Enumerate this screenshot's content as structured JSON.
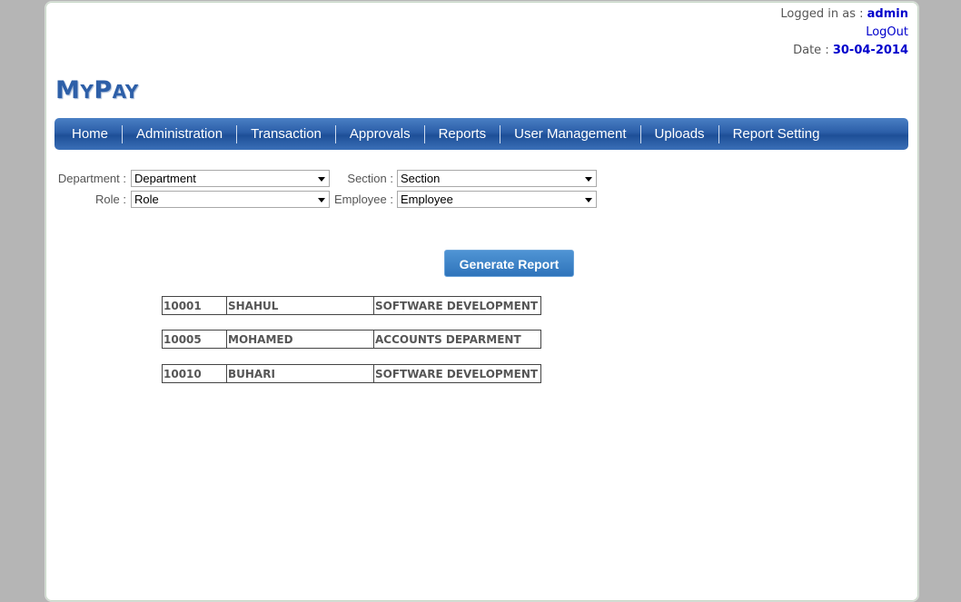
{
  "header": {
    "logged_in_label": "Logged in as :",
    "user": "admin",
    "logout": "LogOut",
    "date_label": "Date :",
    "date": "30-04-2014"
  },
  "logo": {
    "first_big": "M",
    "first_small": "Y",
    "second_big": "P",
    "second_small": "AY"
  },
  "nav": {
    "items": [
      "Home",
      "Administration",
      "Transaction",
      "Approvals",
      "Reports",
      "User Management",
      "Uploads",
      "Report Setting"
    ]
  },
  "filters": {
    "department_label": "Department :",
    "department_value": "Department",
    "section_label": "Section :",
    "section_value": "Section",
    "role_label": "Role :",
    "role_value": "Role",
    "employee_label": "Employee :",
    "employee_value": "Employee"
  },
  "generate_button": "Generate Report",
  "records": [
    {
      "id": "10001",
      "name": "SHAHUL",
      "dept": "SOFTWARE DEVELOPMENT"
    },
    {
      "id": "10005",
      "name": "MOHAMED",
      "dept": "ACCOUNTS DEPARMENT"
    },
    {
      "id": "10010",
      "name": "BUHARI",
      "dept": "SOFTWARE DEVELOPMENT"
    }
  ]
}
